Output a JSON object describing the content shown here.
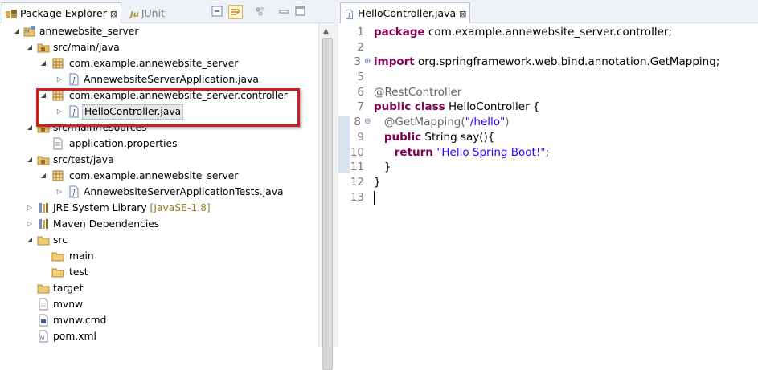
{
  "explorer": {
    "tab_label": "Package Explorer",
    "close_glyph": "⊠",
    "junit_label": "JUnit",
    "junit_prefix": "Ju",
    "toolbar_icons": [
      "collapse-all-icon",
      "link-with-editor-icon",
      "view-menu-icon",
      "minimize-icon",
      "maximize-icon"
    ]
  },
  "tree": [
    {
      "label": "annewebsite_server",
      "icon": "project-icon",
      "expanded": true
    },
    {
      "label": "src/main/java",
      "icon": "source-folder-icon",
      "expanded": true
    },
    {
      "label": "com.example.annewebsite_server",
      "icon": "package-icon",
      "expanded": true
    },
    {
      "label": "AnnewebsiteServerApplication.java",
      "icon": "java-file-icon",
      "expanded": false
    },
    {
      "label": "com.example.annewebsite_server.controller",
      "icon": "package-icon",
      "expanded": true
    },
    {
      "label": "HelloController.java",
      "icon": "java-file-icon",
      "expanded": false,
      "selected": true
    },
    {
      "label": "src/main/resources",
      "icon": "source-folder-icon",
      "expanded": true
    },
    {
      "label": "application.properties",
      "icon": "properties-file-icon"
    },
    {
      "label": "src/test/java",
      "icon": "source-folder-icon",
      "expanded": true
    },
    {
      "label": "com.example.annewebsite_server",
      "icon": "package-icon",
      "expanded": true
    },
    {
      "label": "AnnewebsiteServerApplicationTests.java",
      "icon": "java-file-icon",
      "expanded": false
    },
    {
      "label": "JRE System Library",
      "decoration": "[JavaSE-1.8]",
      "icon": "library-icon",
      "expanded": false
    },
    {
      "label": "Maven Dependencies",
      "icon": "library-icon",
      "expanded": false
    },
    {
      "label": "src",
      "icon": "folder-icon",
      "expanded": true
    },
    {
      "label": "main",
      "icon": "folder-icon"
    },
    {
      "label": "test",
      "icon": "folder-icon"
    },
    {
      "label": "target",
      "icon": "folder-icon"
    },
    {
      "label": "mvnw",
      "icon": "file-icon"
    },
    {
      "label": "mvnw.cmd",
      "icon": "file-icon"
    },
    {
      "label": "pom.xml",
      "icon": "xml-file-icon"
    }
  ],
  "editor": {
    "tab_label": "HelloController.java",
    "close_glyph": "⊠",
    "line_numbers": [
      "1",
      "2",
      "3",
      "5",
      "6",
      "7",
      "8",
      "9",
      "10",
      "11",
      "12",
      "13"
    ],
    "lines": [
      {
        "kw": "package",
        "rest": " com.example.annewebsite_server.controller;"
      },
      {
        "rest": ""
      },
      {
        "kw": "import",
        "rest": " org.springframework.web.bind.annotation.GetMapping;"
      },
      {
        "rest": ""
      },
      {
        "ann": "@RestController"
      },
      {
        "kw": "public class",
        "rest": " HelloController {"
      },
      {
        "indent": "   ",
        "ann": "@GetMapping(",
        "str": "\"/hello\"",
        "tail": ")"
      },
      {
        "indent": "   ",
        "kw": "public",
        "rest": " String say(){"
      },
      {
        "indent": "      ",
        "kw": "return",
        "str": " \"Hello Spring Boot!\"",
        "tail": ";"
      },
      {
        "indent": "   ",
        "rest": "}"
      },
      {
        "rest": "}"
      },
      {
        "rest": ""
      }
    ]
  }
}
